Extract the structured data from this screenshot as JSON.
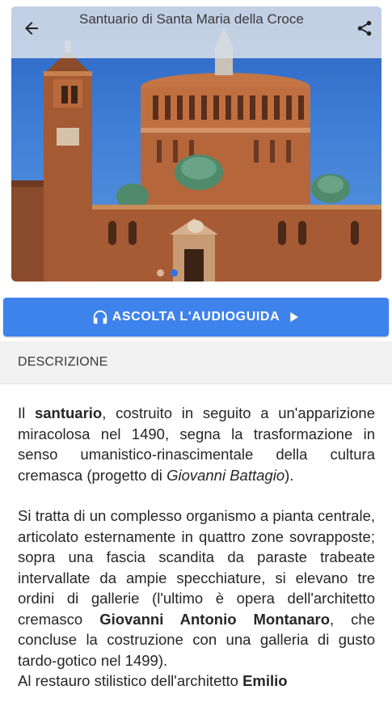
{
  "header": {
    "title": "Santuario di Santa Maria della Croce",
    "back_icon": "arrow-back-icon",
    "share_icon": "share-icon"
  },
  "gallery": {
    "image_description_icon": "photo",
    "dots_total": 2,
    "active_dot": 1
  },
  "audio_button": {
    "label": "ASCOLTA L'AUDIOGUIDA",
    "leading_icon": "headphones-icon",
    "trailing_icon": "play-icon",
    "color": "#3e82ec"
  },
  "section": {
    "title": "DESCRIZIONE"
  },
  "description": {
    "p1": {
      "t1": "Il ",
      "b1": "santuario",
      "t2": ", costruito in seguito a un'apparizione miracolosa nel 1490, segna la trasformazione in senso umanistico-rinascimentale della cultura cremasca (progetto di ",
      "i1": "Giovanni Battagio",
      "t3": ")."
    },
    "p2": {
      "t1": "Si tratta di un complesso organismo a pianta centrale, articolato esternamente in quattro zone sovrapposte; sopra una fascia scandita da paraste trabeate intervallate da ampie specchiature, si elevano tre ordini di gallerie (l'ultimo è opera dell'architetto cremasco ",
      "b1": "Giovanni Antonio Montanaro",
      "t2": ", che concluse la costruzione con una galleria di gusto tardo-gotico nel 1499)."
    },
    "p3": {
      "t1": "Al restauro stilistico dell'architetto ",
      "b1": "Emilio"
    }
  }
}
